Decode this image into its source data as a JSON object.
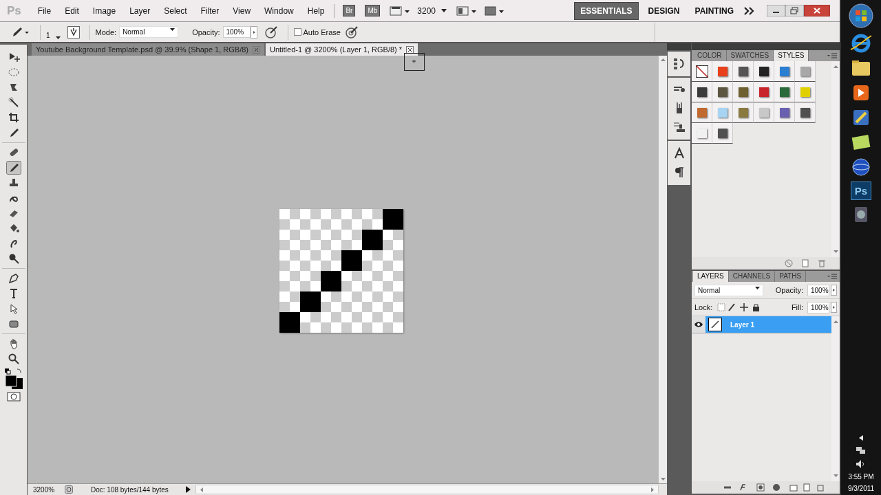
{
  "app": {
    "logo": "Ps"
  },
  "menu": [
    "File",
    "Edit",
    "Image",
    "Layer",
    "Select",
    "Filter",
    "View",
    "Window",
    "Help"
  ],
  "app_bar": {
    "bridge": "Br",
    "mini_bridge": "Mb",
    "zoom": "3200"
  },
  "workspaces": [
    {
      "label": "ESSENTIALS",
      "selected": true
    },
    {
      "label": "DESIGN",
      "selected": false
    },
    {
      "label": "PAINTING",
      "selected": false
    }
  ],
  "options": {
    "brush_size": "1",
    "mode_label": "Mode:",
    "mode": "Normal",
    "opacity_label": "Opacity:",
    "opacity": "100%",
    "auto_erase": {
      "label": "Auto Erase",
      "checked": false
    }
  },
  "documents": [
    {
      "title": "Youtube Background Template.psd @ 39.9% (Shape 1, RGB/8)",
      "selected": false
    },
    {
      "title": "Untitled-1 @ 3200% (Layer 1, RGB/8) *",
      "selected": true
    }
  ],
  "tools": [
    {
      "kind": "move",
      "selected": false
    },
    {
      "kind": "marquee",
      "selected": false
    },
    {
      "kind": "lasso",
      "selected": false
    },
    {
      "kind": "wand",
      "selected": false
    },
    {
      "kind": "crop",
      "selected": false
    },
    {
      "kind": "eyedropper",
      "selected": false
    },
    {
      "kind": "bandage",
      "selected": false
    },
    {
      "kind": "pencil",
      "selected": true
    },
    {
      "kind": "stamp",
      "selected": false
    },
    {
      "kind": "history",
      "selected": false
    },
    {
      "kind": "eraser",
      "selected": false
    },
    {
      "kind": "bucket",
      "selected": false
    },
    {
      "kind": "smudge",
      "selected": false
    },
    {
      "kind": "dodge",
      "selected": false
    },
    {
      "kind": "pen",
      "selected": false
    },
    {
      "kind": "type",
      "selected": false
    },
    {
      "kind": "arrow",
      "selected": false
    },
    {
      "kind": "shape",
      "selected": false
    },
    {
      "kind": "hand",
      "selected": false
    },
    {
      "kind": "zoom",
      "selected": false
    }
  ],
  "style_panel": {
    "tabs": [
      {
        "label": "COLOR",
        "selected": false
      },
      {
        "label": "SWATCHES",
        "selected": false
      },
      {
        "label": "STYLES",
        "selected": true
      }
    ],
    "styles": [
      {
        "color": "#ffffff"
      },
      {
        "color": "#e8401a"
      },
      {
        "color": "#555555"
      },
      {
        "color": "#222222"
      },
      {
        "color": "#2a7fd0"
      },
      {
        "color": "#a8a8a8"
      },
      {
        "color": "#3a3a3a"
      },
      {
        "color": "#5c5540"
      },
      {
        "color": "#6e6030"
      },
      {
        "color": "#c8242c"
      },
      {
        "color": "#2a6a3a"
      },
      {
        "color": "#e0d000"
      },
      {
        "color": "#c06a30"
      },
      {
        "color": "#a8d4f4"
      },
      {
        "color": "#8a7a40"
      },
      {
        "color": "#c8c8c8"
      },
      {
        "color": "#6a60b0"
      },
      {
        "color": "#505050"
      },
      {
        "color": "#f0f0f0"
      },
      {
        "color": "#505050"
      }
    ]
  },
  "layers_panel": {
    "tabs": [
      {
        "label": "LAYERS",
        "selected": true
      },
      {
        "label": "CHANNELS",
        "selected": false
      },
      {
        "label": "PATHS",
        "selected": false
      }
    ],
    "blend_mode": "Normal",
    "opacity_label": "Opacity:",
    "opacity": "100%",
    "lock_label": "Lock:",
    "fill_label": "Fill:",
    "fill": "100%",
    "layers": [
      {
        "name": "Layer 1",
        "visible": true,
        "selected": true
      }
    ]
  },
  "status_bar": {
    "zoom": "3200%",
    "doc": "Doc: 108 bytes/144 bytes"
  },
  "taskbar": {
    "time": "3:55 PM",
    "date": "9/3/2011",
    "ps": "Ps"
  }
}
